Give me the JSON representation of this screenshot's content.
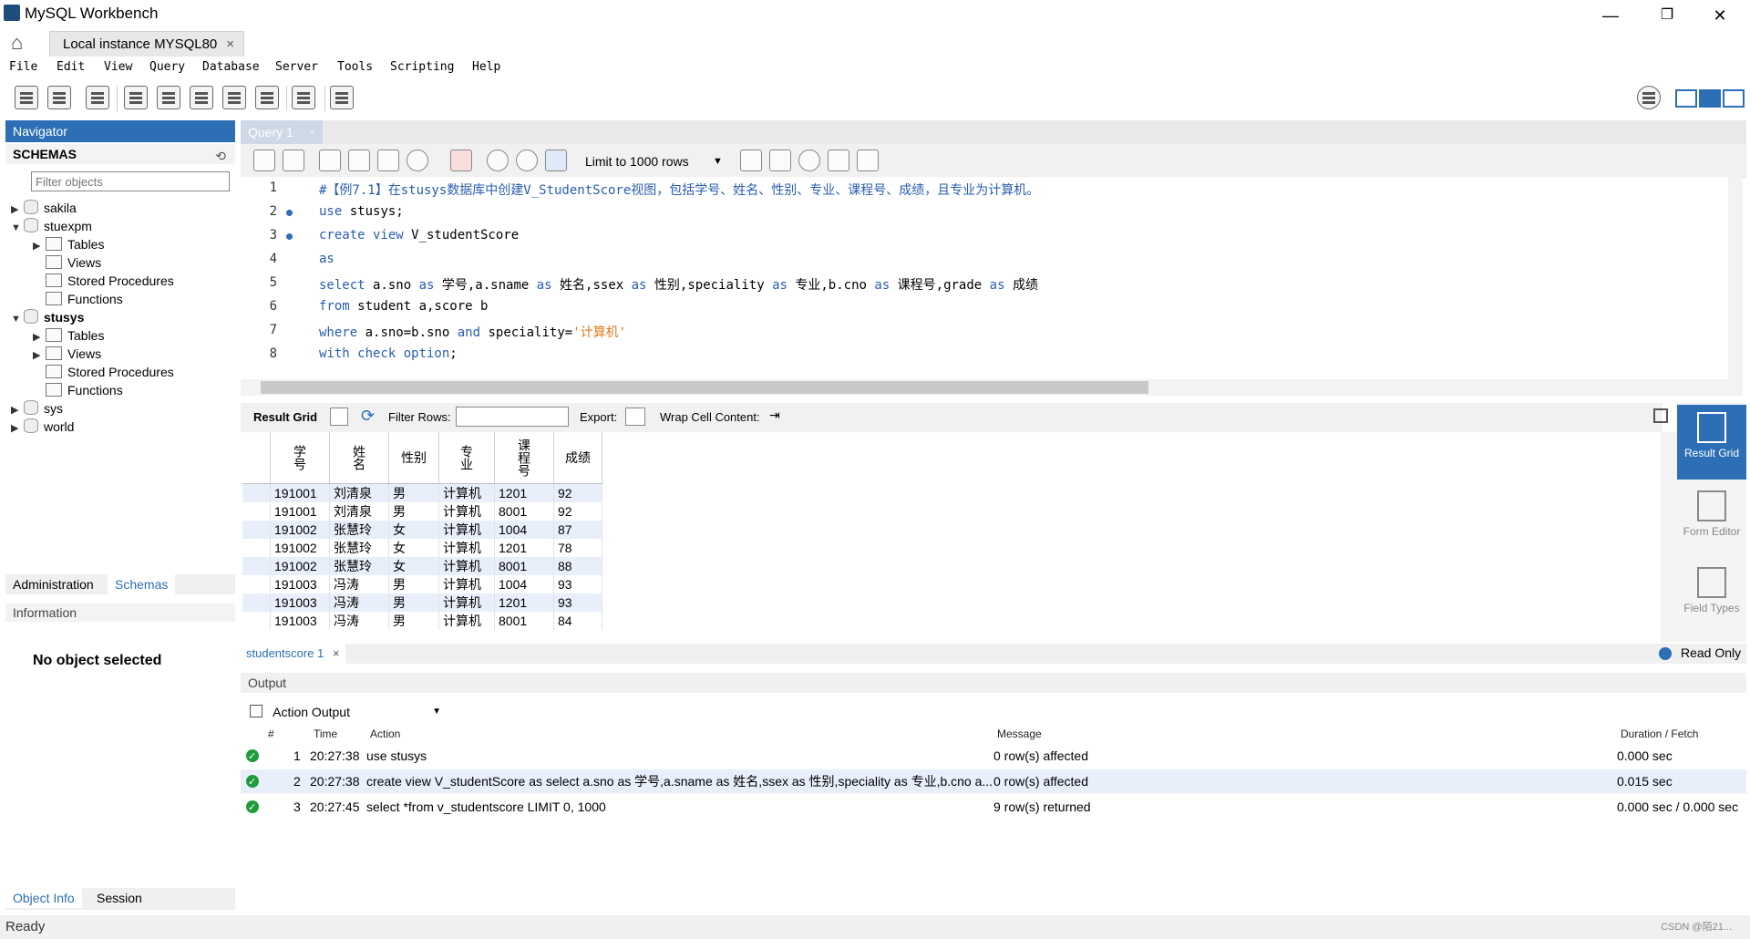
{
  "window": {
    "title": "MySQL Workbench",
    "minimize": "—",
    "maximize": "❐",
    "close": "✕"
  },
  "connection_tab": {
    "label": "Local instance MYSQL80",
    "close": "×"
  },
  "menu": [
    "File",
    "Edit",
    "View",
    "Query",
    "Database",
    "Server",
    "Tools",
    "Scripting",
    "Help"
  ],
  "navigator": {
    "title": "Navigator",
    "schemas_label": "SCHEMAS",
    "filter_placeholder": "Filter objects",
    "tree": [
      {
        "label": "sakila"
      },
      {
        "label": "stuexpm"
      },
      {
        "label": "Tables"
      },
      {
        "label": "Views"
      },
      {
        "label": "Stored Procedures"
      },
      {
        "label": "Functions"
      },
      {
        "label": "stusys"
      },
      {
        "label": "Tables"
      },
      {
        "label": "Views"
      },
      {
        "label": "Stored Procedures"
      },
      {
        "label": "Functions"
      },
      {
        "label": "sys"
      },
      {
        "label": "world"
      }
    ],
    "tabs": [
      "Administration",
      "Schemas"
    ],
    "information_label": "Information",
    "no_object": "No object selected",
    "bottom_tabs": [
      "Object Info",
      "Session"
    ]
  },
  "query_tab": {
    "label": "Query 1",
    "close": "×"
  },
  "editor_toolbar": {
    "limit": "Limit to 1000 rows"
  },
  "editor": {
    "line_numbers": [
      "1",
      "2",
      "3",
      "4",
      "5",
      "6",
      "7",
      "8"
    ],
    "lines": [
      {
        "parts": [
          {
            "t": "#【例7.1】在stusys数据库中创建V_StudentScore视图，包括学号、姓名、性别、专业、课程号、成绩，且专业为计算机。",
            "c": "cm"
          }
        ]
      },
      {
        "parts": [
          {
            "t": "use",
            "c": "kw"
          },
          {
            "t": " stusys;",
            "c": ""
          }
        ]
      },
      {
        "parts": [
          {
            "t": "create view",
            "c": "kw"
          },
          {
            "t": " V_studentScore",
            "c": ""
          }
        ]
      },
      {
        "parts": [
          {
            "t": "as",
            "c": "kw"
          }
        ]
      },
      {
        "parts": [
          {
            "t": "select",
            "c": "kw"
          },
          {
            "t": " a.sno ",
            "c": ""
          },
          {
            "t": "as",
            "c": "kw"
          },
          {
            "t": " 学号,a.sname ",
            "c": ""
          },
          {
            "t": "as",
            "c": "kw"
          },
          {
            "t": " 姓名,ssex ",
            "c": ""
          },
          {
            "t": "as",
            "c": "kw"
          },
          {
            "t": " 性别,speciality ",
            "c": ""
          },
          {
            "t": "as",
            "c": "kw"
          },
          {
            "t": " 专业,b.cno ",
            "c": ""
          },
          {
            "t": "as",
            "c": "kw"
          },
          {
            "t": " 课程号,grade ",
            "c": ""
          },
          {
            "t": "as",
            "c": "kw"
          },
          {
            "t": " 成绩",
            "c": ""
          }
        ]
      },
      {
        "parts": [
          {
            "t": "from",
            "c": "kw"
          },
          {
            "t": " student a,score b",
            "c": ""
          }
        ]
      },
      {
        "parts": [
          {
            "t": "where",
            "c": "kw"
          },
          {
            "t": " a.sno=b.sno ",
            "c": ""
          },
          {
            "t": "and",
            "c": "kw"
          },
          {
            "t": " speciality=",
            "c": ""
          },
          {
            "t": "'计算机'",
            "c": "str"
          }
        ]
      },
      {
        "parts": [
          {
            "t": "with check option",
            "c": "kw"
          },
          {
            "t": ";",
            "c": ""
          }
        ]
      }
    ]
  },
  "result_toolbar": {
    "result_grid": "Result Grid",
    "filter_rows": "Filter Rows:",
    "export": "Export:",
    "wrap": "Wrap Cell Content:"
  },
  "result": {
    "columns": [
      "学号",
      "姓名",
      "性别",
      "专业",
      "课程号",
      "成绩"
    ],
    "rows": [
      [
        "191001",
        "刘清泉",
        "男",
        "计算机",
        "1201",
        "92"
      ],
      [
        "191001",
        "刘清泉",
        "男",
        "计算机",
        "8001",
        "92"
      ],
      [
        "191002",
        "张慧玲",
        "女",
        "计算机",
        "1004",
        "87"
      ],
      [
        "191002",
        "张慧玲",
        "女",
        "计算机",
        "1201",
        "78"
      ],
      [
        "191002",
        "张慧玲",
        "女",
        "计算机",
        "8001",
        "88"
      ],
      [
        "191003",
        "冯涛",
        "男",
        "计算机",
        "1004",
        "93"
      ],
      [
        "191003",
        "冯涛",
        "男",
        "计算机",
        "1201",
        "93"
      ],
      [
        "191003",
        "冯涛",
        "男",
        "计算机",
        "8001",
        "84"
      ]
    ]
  },
  "side_buttons": [
    {
      "label": "Result Grid",
      "active": true
    },
    {
      "label": "Form Editor",
      "active": false
    },
    {
      "label": "Field Types",
      "active": false
    }
  ],
  "result_tab": {
    "label": "studentscore 1",
    "close": "×",
    "read_only": "Read Only"
  },
  "output": {
    "title": "Output",
    "selector": "Action Output",
    "headers": [
      "#",
      "Time",
      "Action",
      "Message",
      "Duration / Fetch"
    ],
    "rows": [
      {
        "n": "1",
        "time": "20:27:38",
        "action": "use stusys",
        "message": "0 row(s) affected",
        "duration": "0.000 sec"
      },
      {
        "n": "2",
        "time": "20:27:38",
        "action": "create view V_studentScore as  select a.sno as 学号,a.sname as 姓名,ssex as 性别,speciality as 专业,b.cno a...",
        "message": "0 row(s) affected",
        "duration": "0.015 sec"
      },
      {
        "n": "3",
        "time": "20:27:45",
        "action": "select *from v_studentscore LIMIT 0, 1000",
        "message": "9 row(s) returned",
        "duration": "0.000 sec / 0.000 sec"
      }
    ]
  },
  "status": {
    "text": "Ready",
    "watermark": "CSDN @陌21..."
  }
}
